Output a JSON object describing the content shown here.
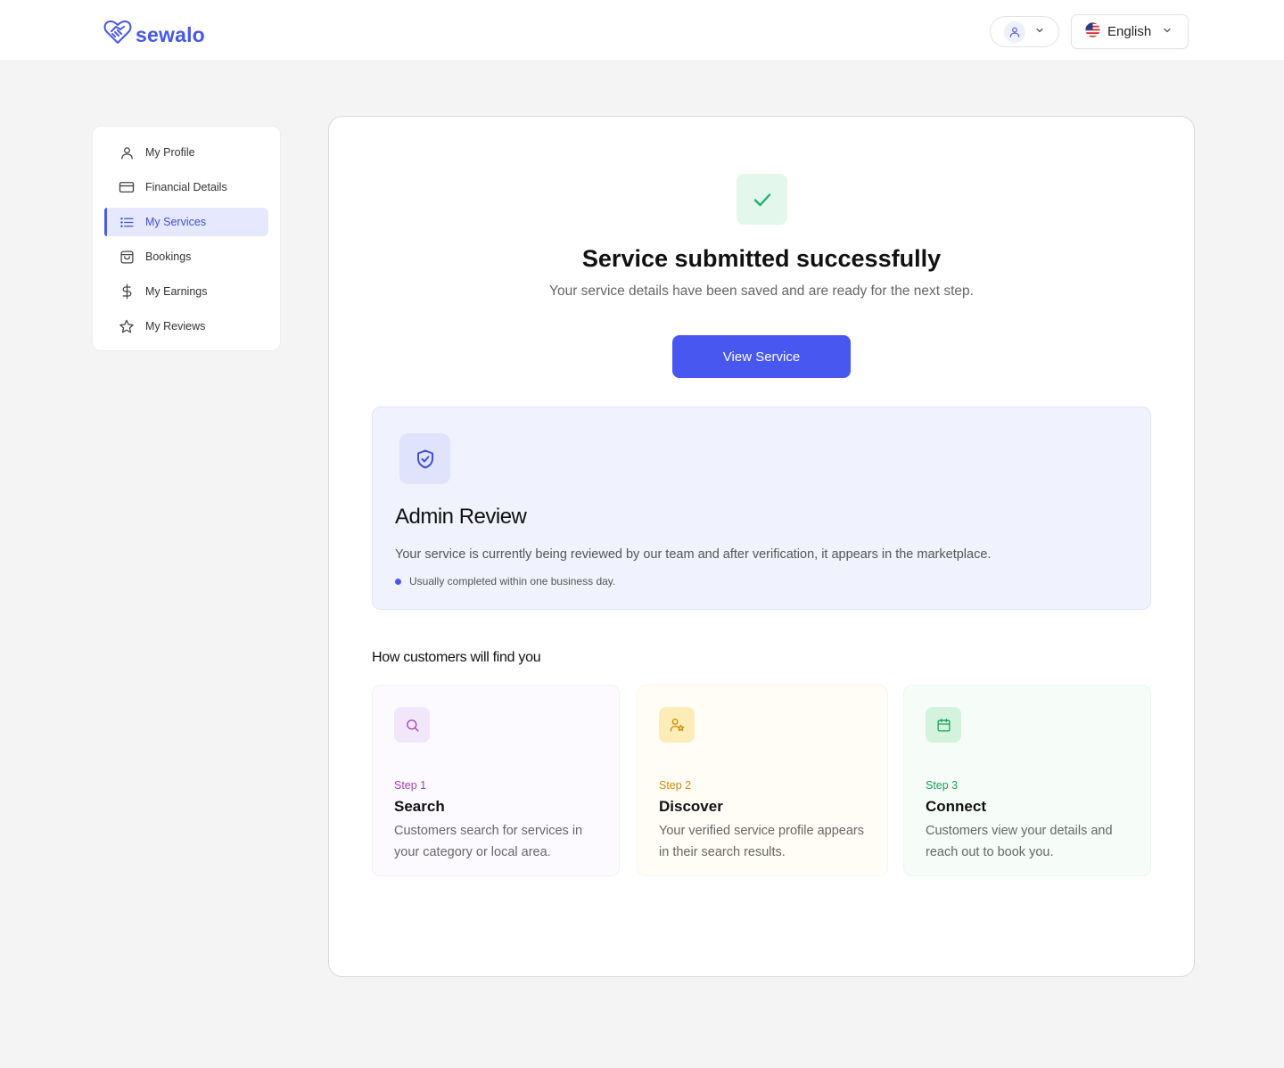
{
  "brand": {
    "name": "sewalo"
  },
  "header": {
    "user_menu_icon": "user-icon",
    "language": {
      "label": "English",
      "flag": "us-flag-icon"
    }
  },
  "sidebar": {
    "items": [
      {
        "label": "My Profile",
        "icon": "user-icon",
        "active": false
      },
      {
        "label": "Financial Details",
        "icon": "credit-card-icon",
        "active": false
      },
      {
        "label": "My Services",
        "icon": "list-icon",
        "active": true
      },
      {
        "label": "Bookings",
        "icon": "shopping-bag-icon",
        "active": false
      },
      {
        "label": "My Earnings",
        "icon": "dollar-icon",
        "active": false
      },
      {
        "label": "My Reviews",
        "icon": "star-icon",
        "active": false
      }
    ]
  },
  "success": {
    "title": "Service submitted successfully",
    "subtitle": "Your service details have been saved and are ready for the next step.",
    "button_label": "View Service"
  },
  "review": {
    "title": "Admin Review",
    "description": "Your service is currently being reviewed by our team and after verification, it appears in the marketplace.",
    "note": "Usually completed within one business day."
  },
  "how": {
    "title": "How customers will find you",
    "steps": [
      {
        "step": "Step 1",
        "title": "Search",
        "description": "Customers search for services in your category or local area.",
        "icon": "search-icon"
      },
      {
        "step": "Step 2",
        "title": "Discover",
        "description": "Your verified service profile appears in their search results.",
        "icon": "user-star-icon"
      },
      {
        "step": "Step 3",
        "title": "Connect",
        "description": "Customers view your details and reach out to book you.",
        "icon": "calendar-icon"
      }
    ]
  },
  "colors": {
    "accent": "#4757f0",
    "success": "#1fb36b",
    "background": "#f4f4f4"
  }
}
